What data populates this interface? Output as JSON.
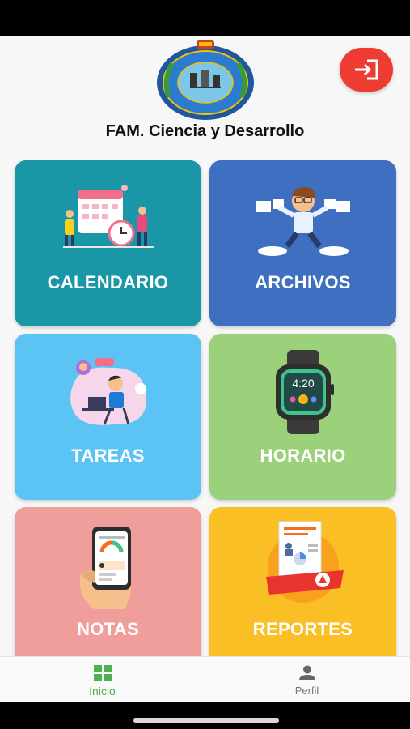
{
  "header": {
    "title": "FAM. Ciencia y Desarrollo"
  },
  "tiles": [
    {
      "label": "CALENDARIO",
      "color": "#1a97a6"
    },
    {
      "label": "ARCHIVOS",
      "color": "#3f6fc0"
    },
    {
      "label": "TAREAS",
      "color": "#5bc4f4"
    },
    {
      "label": "HORARIO",
      "color": "#9bd17b",
      "clock_text": "4:20"
    },
    {
      "label": "NOTAS",
      "color": "#ef9e9b"
    },
    {
      "label": "REPORTES",
      "color": "#fbbf26"
    }
  ],
  "nav": {
    "home_label": "Inicio",
    "profile_label": "Perfil",
    "active_color": "#4caf50"
  },
  "colors": {
    "logout": "#ef3c32"
  },
  "icons": [
    "logout-icon",
    "school-logo",
    "calendar-illustration",
    "files-illustration",
    "tasks-illustration",
    "smartwatch-illustration",
    "grades-phone-illustration",
    "report-illustration",
    "grid-icon",
    "person-icon"
  ]
}
